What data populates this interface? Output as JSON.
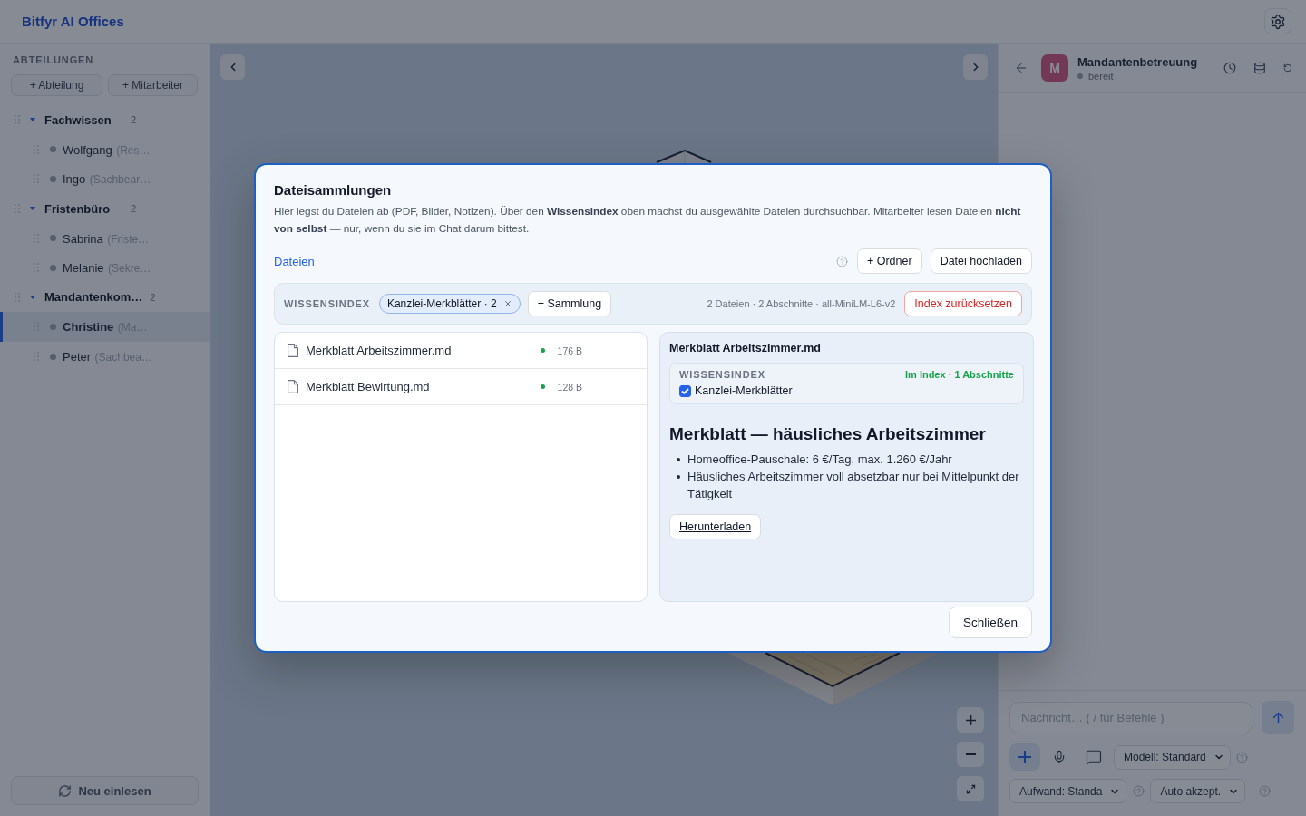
{
  "header": {
    "title": "Bitfyr AI Offices"
  },
  "sidebar": {
    "heading": "ABTEILUNGEN",
    "buttons": [
      "+ Abteilung",
      "+ Mitarbeiter"
    ],
    "departments": [
      {
        "name": "Fachwissen",
        "count": "2",
        "expanded": true,
        "children": [
          {
            "name": "Wolfgang",
            "role": "(Res…",
            "selected": false
          },
          {
            "name": "Ingo",
            "role": "(Sachbear…",
            "selected": false
          }
        ]
      },
      {
        "name": "Fristenbüro",
        "count": "2",
        "expanded": true,
        "children": [
          {
            "name": "Sabrina",
            "role": "(Friste…",
            "selected": false
          },
          {
            "name": "Melanie",
            "role": "(Sekre…",
            "selected": false
          }
        ]
      },
      {
        "name": "Mandantenkom…",
        "count": "2",
        "expanded": true,
        "children": [
          {
            "name": "Christine",
            "role": "(Ma…",
            "selected": true
          },
          {
            "name": "Peter",
            "role": "(Sachbea…",
            "selected": false
          }
        ]
      }
    ],
    "reload_button": "Neu einlesen"
  },
  "chat": {
    "avatar": "M",
    "title": "Mandantenbetreuung",
    "status": "bereit",
    "composer": {
      "placeholder": "Nachricht… ( / für Befehle )",
      "selects": [
        "Modell: Standard",
        "Aufwand: Standa",
        "Auto akzept."
      ]
    }
  },
  "dialog": {
    "title": "Dateisammlungen",
    "description": "Hier legst du Dateien ab (PDF, Bilder, Notizen). Über den **Wissensindex** oben machst du ausgewählte Dateien durchsuchbar. Mitarbeiter lesen Dateien **nicht von selbst** — nur, wenn du sie im Chat darum bittest.",
    "breadcrumb": "Dateien",
    "actions": [
      "+ Ordner",
      "Datei hochladen"
    ],
    "index_bar": {
      "label": "WISSENSINDEX",
      "collections": [
        {
          "label": "Kanzlei-Merkblätter · 2"
        }
      ],
      "add_button": "+ Sammlung",
      "stats": "2 Dateien · 2 Abschnitte · all-MiniLM-L6-v2",
      "reset_button": "Index zurücksetzen"
    },
    "files": [
      {
        "name": "Merkblatt Arbeitszimmer.md",
        "indexed": true,
        "size": "176 B"
      },
      {
        "name": "Merkblatt Bewirtung.md",
        "indexed": true,
        "size": "128 B"
      }
    ],
    "preview": {
      "filename": "Merkblatt Arbeitszimmer.md",
      "index": {
        "label": "WISSENSINDEX",
        "status": "Im Index · 1 Abschnitte",
        "collections": [
          {
            "label": "Kanzlei-Merkblätter",
            "checked": true
          }
        ]
      },
      "heading": "Merkblatt — häusliches Arbeitszimmer",
      "bullets": [
        "Homeoffice-Pauschale: 6 €/Tag, max. 1.260 €/Jahr",
        "Häusliches Arbeitszimmer voll absetzbar nur bei Mittelpunkt der Tätigkeit"
      ],
      "download_button": "Herunterladen"
    },
    "close_button": "Schließen"
  }
}
